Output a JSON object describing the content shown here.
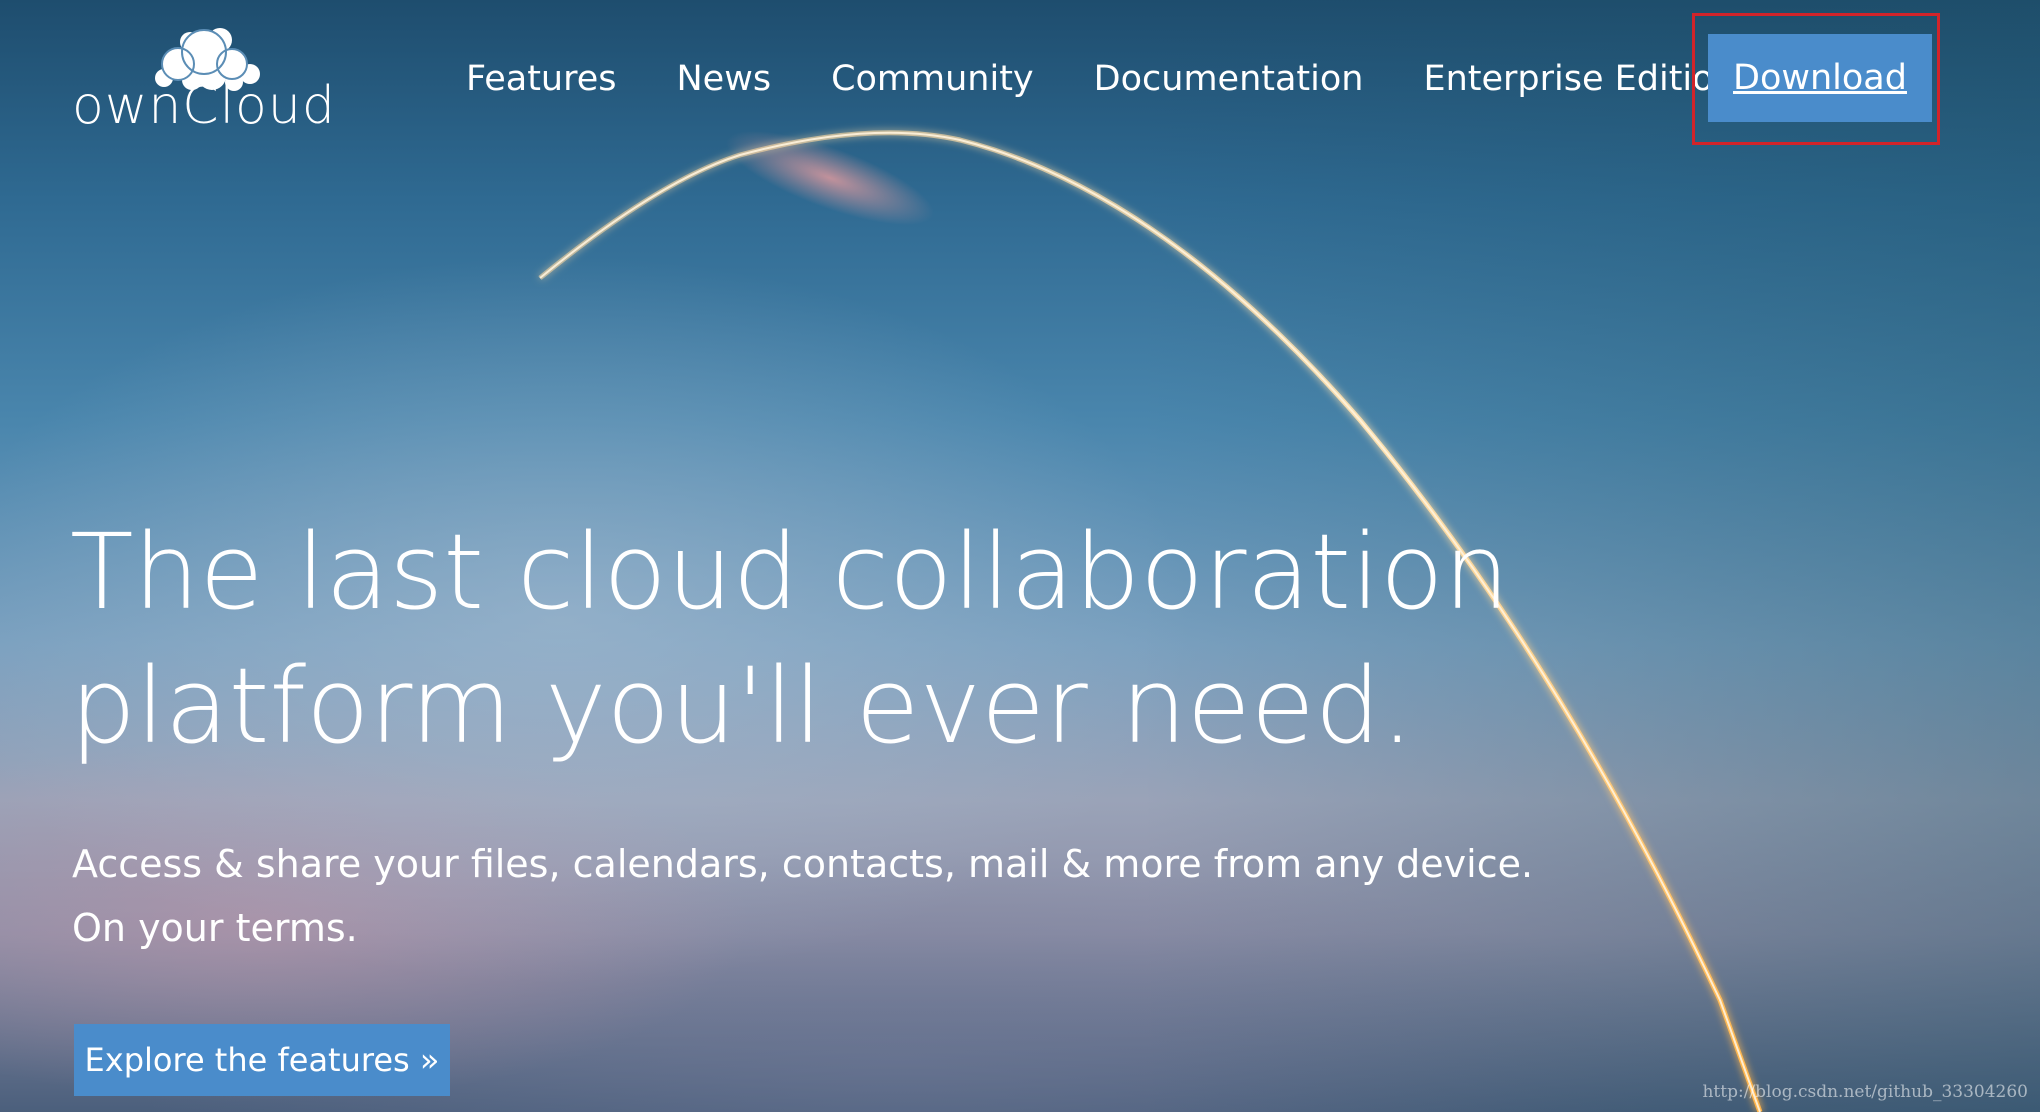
{
  "brand": {
    "name": "ownCloud",
    "icon": "cloud-logo-icon"
  },
  "nav": {
    "items": [
      {
        "label": "Features"
      },
      {
        "label": "News"
      },
      {
        "label": "Community"
      },
      {
        "label": "Documentation"
      },
      {
        "label": "Enterprise Edition"
      }
    ],
    "download_label": "Download"
  },
  "hero": {
    "title_line1": "The last cloud collaboration",
    "title_line2": "platform you'll ever need.",
    "subtitle_line1": "Access & share your files, calendars, contacts, mail & more from any device.",
    "subtitle_line2": "On your terms.",
    "cta_label": "Explore the features »"
  },
  "watermark": "http://blog.csdn.net/github_33304260",
  "colors": {
    "button_blue": "#4a8ccb",
    "highlight_red": "#d2242a",
    "text": "#ffffff"
  }
}
